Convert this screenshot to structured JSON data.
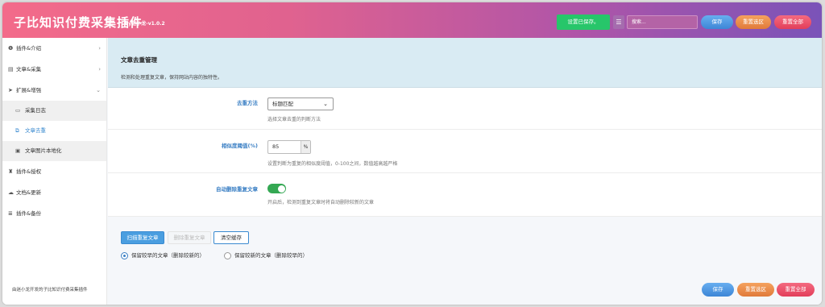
{
  "header": {
    "title": "子比知识付费采集插件",
    "version": "by迷小龙-v1.0.2",
    "saved_badge": "设置已保存。",
    "menu_icon": "list-icon",
    "search_placeholder": "搜索...",
    "save_label": "保存",
    "reset_section_label": "重置选区",
    "reset_all_label": "重置全部"
  },
  "sidebar": {
    "items": [
      {
        "label": "插件&介绍",
        "icon": "info-icon"
      },
      {
        "label": "文章&采集",
        "icon": "document-icon"
      },
      {
        "label": "扩展&增强",
        "icon": "rocket-icon"
      },
      {
        "label": "采集日志",
        "icon": "log-icon"
      },
      {
        "label": "文章去重",
        "icon": "copy-icon"
      },
      {
        "label": "文章图片本地化",
        "icon": "image-icon"
      },
      {
        "label": "插件&授权",
        "icon": "license-icon"
      },
      {
        "label": "文档&更新",
        "icon": "cloud-icon"
      },
      {
        "label": "插件&备份",
        "icon": "database-icon"
      }
    ],
    "footer": "由迷小龙开发的子比知识付费采集插件"
  },
  "main": {
    "title": "文章去重管理",
    "description": "检测和处理重复文章，保持网站内容的独特性。",
    "dedup_method": {
      "label": "去重方法",
      "value": "标题匹配",
      "hint": "选择文章去重的判断方法"
    },
    "similarity": {
      "label": "相似度阈值(%)",
      "value": "85",
      "unit": "%",
      "hint": "设置判断为重复的相似度阈值，0-100之间，数值越高越严格"
    },
    "auto_delete": {
      "label": "自动删除重复文章",
      "enabled": true,
      "hint": "开启后，检测到重复文章时将自动删除较新的文章"
    },
    "actions": {
      "scan": "扫描重复文章",
      "delete": "删除重复文章",
      "clear_cache": "清空缓存"
    },
    "keep_options": [
      {
        "label": "保留较早的文章（删除较新的）",
        "selected": true
      },
      {
        "label": "保留较新的文章（删除较早的）",
        "selected": false
      }
    ]
  },
  "footer_buttons": {
    "save": "保存",
    "reset_section": "重置选区",
    "reset_all": "重置全部"
  },
  "colors": {
    "save": "#4a90e2",
    "reset_section": "#f0904a",
    "reset_all": "#ef4a66",
    "toggle_on": "#34a853"
  }
}
